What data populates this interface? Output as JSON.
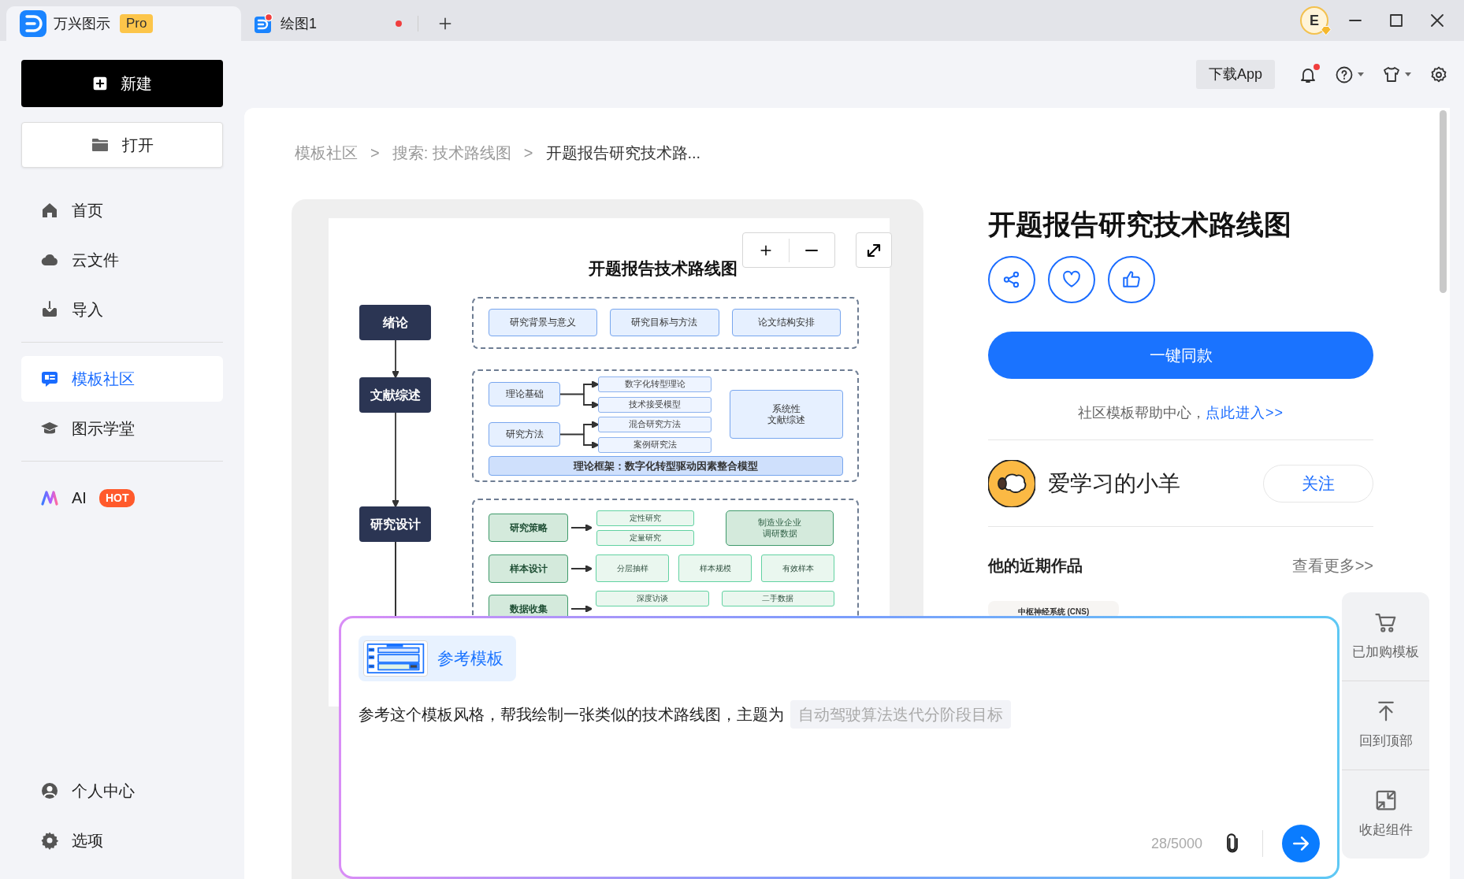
{
  "title_bar": {
    "tabs": [
      {
        "kind": "home",
        "label": "万兴图示",
        "badge": "Pro",
        "selected": true,
        "unsaved": false
      },
      {
        "kind": "doc",
        "label": "绘图1",
        "selected": false,
        "unsaved": true
      }
    ],
    "user_initial": "E"
  },
  "sidebar": {
    "new_button": "新建",
    "open_button": "打开",
    "items": [
      {
        "kind": "home",
        "label": "首页",
        "selected": false
      },
      {
        "kind": "cloud",
        "label": "云文件",
        "selected": false
      },
      {
        "kind": "import",
        "label": "导入",
        "selected": false
      },
      {
        "kind": "template",
        "label": "模板社区",
        "selected": true
      },
      {
        "kind": "school",
        "label": "图示学堂",
        "selected": false
      },
      {
        "kind": "ai",
        "label": "AI",
        "badge": "HOT",
        "selected": false
      }
    ],
    "bottom_items": [
      {
        "kind": "user",
        "label": "个人中心"
      },
      {
        "kind": "gear",
        "label": "选项"
      }
    ]
  },
  "toolbar": {
    "download_button": "下载App",
    "notifications_unread": true
  },
  "breadcrumb": [
    {
      "kind": "link",
      "text": "模板社区"
    },
    {
      "kind": "sep",
      "text": ">"
    },
    {
      "kind": "link",
      "text": "搜索: 技术路线图"
    },
    {
      "kind": "sep",
      "text": ">"
    },
    {
      "kind": "current",
      "text": "开题报告研究技术路..."
    }
  ],
  "diagram": {
    "title": "开题报告技术路线图",
    "stages": [
      "绪论",
      "文献综述",
      "研究设计"
    ],
    "groups": [
      {
        "kind": "row",
        "items": [
          "研究背景与意义",
          "研究目标与方法",
          "论文结构安排"
        ]
      },
      {
        "kind": "branches",
        "branches": [
          {
            "label": "理论基础",
            "children": [
              "数字化转型理论",
              "技术接受模型"
            ]
          },
          {
            "label": "研究方法",
            "children": [
              "混合研究方法",
              "案例研究法"
            ]
          }
        ],
        "side": [
          "系统性",
          "文献综述"
        ],
        "footer": "理论框架：数字化转型驱动因素整合模型"
      },
      {
        "kind": "rows",
        "rows": [
          {
            "kind": "stack",
            "label": "研究策略",
            "children": [
              "定性研究",
              "定量研究"
            ],
            "side": [
              "制造业企业",
              "调研数据"
            ]
          },
          {
            "kind": "inline",
            "label": "样本设计",
            "children": [
              "分层抽样",
              "样本规模",
              "有效样本"
            ]
          },
          {
            "kind": "grid",
            "label": "数据收集",
            "children": [
              "深度访谈",
              "二手数据"
            ]
          }
        ]
      }
    ]
  },
  "detail": {
    "title": "开题报告研究技术路线图",
    "action_button": "一键同款",
    "help_text": "社区模板帮助中心，",
    "help_link": "点此进入>>",
    "author": {
      "name": "爱学习的小羊",
      "follow_button": "关注"
    },
    "recent": {
      "heading": "他的近期作品",
      "more_link": "查看更多>>",
      "items": [
        {
          "thumbnail_caption": "中枢神经系统 (CNS)"
        }
      ]
    }
  },
  "side_tools": [
    {
      "kind": "cart",
      "label": "已加购模板"
    },
    {
      "kind": "top",
      "label": "回到顶部"
    },
    {
      "kind": "collapse",
      "label": "收起组件"
    }
  ],
  "ai_panel": {
    "reference_chip": "参考模板",
    "prompt": "参考这个模板风格，帮我绘制一张类似的技术路线图，主题为",
    "topic_placeholder": "自动驾驶算法迭代分阶段目标",
    "counter": "28/5000"
  }
}
